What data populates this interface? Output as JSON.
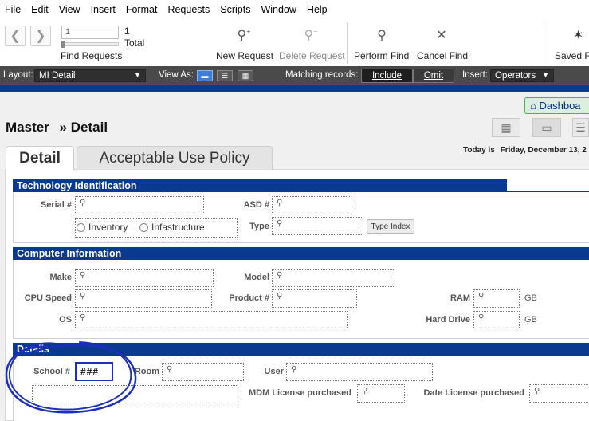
{
  "menubar": {
    "items": [
      "File",
      "Edit",
      "View",
      "Insert",
      "Format",
      "Requests",
      "Scripts",
      "Window",
      "Help"
    ]
  },
  "toolbar": {
    "record_value": "1",
    "total_count": "1",
    "total_label": "Total",
    "find_requests_label": "Find Requests",
    "new_request": "New Request",
    "delete_request": "Delete Request",
    "perform_find": "Perform Find",
    "cancel_find": "Cancel Find",
    "saved_finds": "Saved Fi",
    "icons": {
      "new_request": "magnifier-plus-icon",
      "delete_request": "magnifier-minus-icon",
      "perform_find": "perform-find-icon",
      "cancel_find": "close-icon",
      "saved_finds": "star-icon"
    }
  },
  "layoutbar": {
    "layout_label": "Layout:",
    "layout_value": "MI Detail",
    "view_as_label": "View As:",
    "matching_label": "Matching records:",
    "include_label": "Include",
    "omit_label": "Omit",
    "insert_label": "Insert:",
    "operators_label": "Operators",
    "bar_color": "#4a4a4a"
  },
  "header": {
    "dashboard_label": "Dashboa",
    "title_master": "Master",
    "title_separator": "»",
    "title_detail": "Detail",
    "today_label": "Today is",
    "today_value": "Friday, December 13, 2"
  },
  "tabs": [
    {
      "label": "Detail",
      "active": true
    },
    {
      "label": "Acceptable Use Policy",
      "active": false
    }
  ],
  "sections": {
    "tech_id": {
      "title": "Technology Identification",
      "serial_label": "Serial #",
      "asd_label": "ASD #",
      "type_label": "Type",
      "type_index_button": "Type Index",
      "radio_options": [
        "Inventory",
        "Infastructure"
      ]
    },
    "computer_info": {
      "title": "Computer Information",
      "make_label": "Make",
      "model_label": "Model",
      "cpu_label": "CPU Speed",
      "product_label": "Product #",
      "ram_label": "RAM",
      "ram_unit": "GB",
      "os_label": "OS",
      "hdd_label": "Hard Drive",
      "hdd_unit": "GB"
    },
    "details": {
      "title": "Details",
      "school_label": "School #",
      "school_value": "###",
      "room_label": "Room",
      "user_label": "User",
      "mdm_label": "MDM License purchased",
      "date_license_label": "Date License purchased"
    }
  },
  "colors": {
    "section_header": "#0a3a8f",
    "dashboard_bg": "#d9f0da",
    "annotation": "#1b2fb8"
  }
}
